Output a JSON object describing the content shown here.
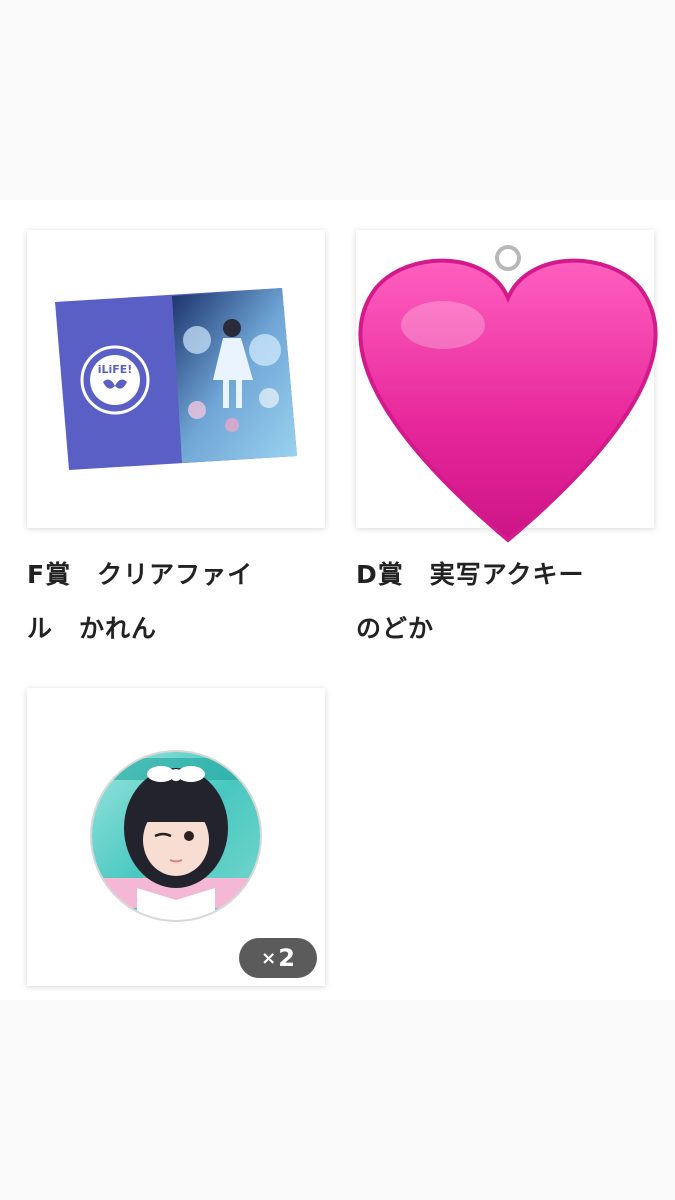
{
  "items": [
    {
      "title_line1": "F賞　クリアファイ",
      "title_line2": "ル　かれん",
      "file_logo_text": "iLiFE!",
      "icon": "clear-file-image"
    },
    {
      "title_line1": "D賞　実写アクキー",
      "title_line2": "のどか",
      "icon": "heart-icon",
      "heart_color": "#e6269a"
    },
    {
      "icon": "badge-photo-image",
      "quantity_x": "×",
      "quantity_value": "2"
    }
  ]
}
